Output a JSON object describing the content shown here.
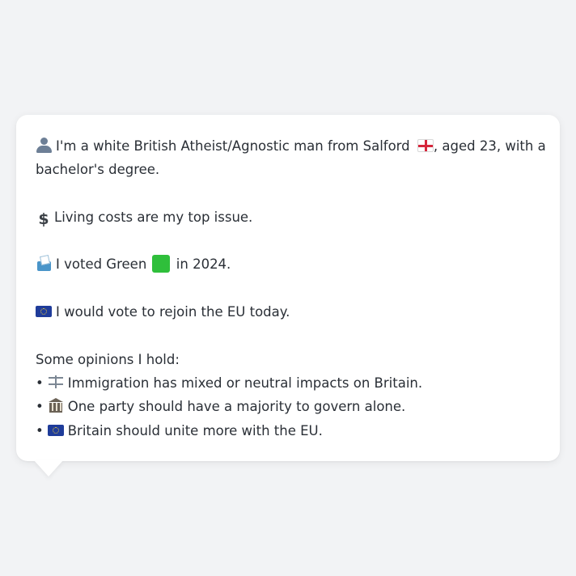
{
  "profile": {
    "intro_line1": "I'm a white British Atheist/Agnostic man from Salford",
    "intro_line1_suffix": ", aged 23, with a",
    "intro_line2": "bachelor's degree.",
    "top_issue": "Living costs are my top issue.",
    "vote_prefix": "I voted Green",
    "vote_suffix": "in 2024.",
    "eu_stance": "I would vote to rejoin the EU today.",
    "opinions_heading": "Some opinions I hold:",
    "opinions": [
      {
        "icon": "scales-icon",
        "text": "Immigration has mixed or neutral impacts on Britain."
      },
      {
        "icon": "classical-building-icon",
        "text": "One party should have a majority to govern alone."
      },
      {
        "icon": "eu-flag-icon",
        "text": "Britain should unite more with the EU."
      }
    ],
    "bullet": "•",
    "dollar_symbol": "$"
  },
  "colors": {
    "background": "#f2f3f5",
    "card": "#ffffff",
    "text": "#2a2f36",
    "green_square": "#2fbf3b"
  }
}
